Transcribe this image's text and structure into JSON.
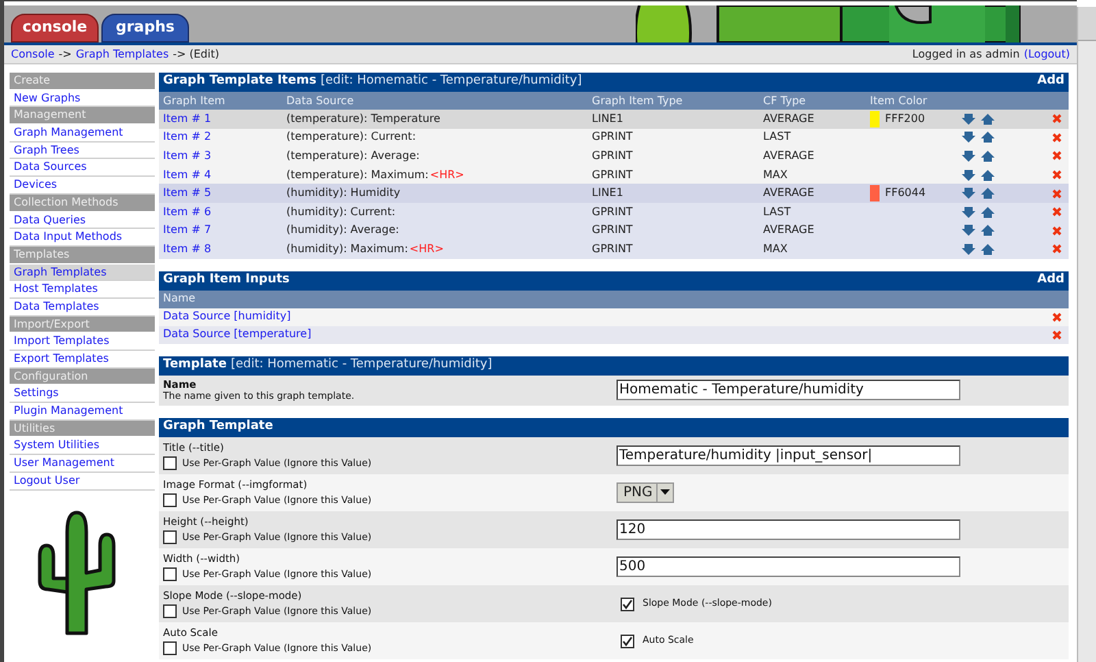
{
  "tabs": [
    {
      "label": "console",
      "selected": true
    },
    {
      "label": "graphs",
      "selected": false
    }
  ],
  "breadcrumb": [
    {
      "label": "Console",
      "kind": "link"
    },
    {
      "label": "->",
      "kind": "sep"
    },
    {
      "label": "Graph Templates",
      "kind": "link"
    },
    {
      "label": "-> (Edit)",
      "kind": "sep"
    }
  ],
  "login": {
    "text": "Logged in as admin",
    "link": "(Logout)"
  },
  "sidebar": [
    {
      "label": "Create",
      "kind": "header"
    },
    {
      "label": "New Graphs",
      "kind": "item",
      "selected": false
    },
    {
      "label": "Management",
      "kind": "header"
    },
    {
      "label": "Graph Management",
      "kind": "item",
      "selected": false
    },
    {
      "label": "Graph Trees",
      "kind": "item",
      "selected": false
    },
    {
      "label": "Data Sources",
      "kind": "item",
      "selected": false
    },
    {
      "label": "Devices",
      "kind": "item",
      "selected": false
    },
    {
      "label": "Collection Methods",
      "kind": "header"
    },
    {
      "label": "Data Queries",
      "kind": "item",
      "selected": false
    },
    {
      "label": "Data Input Methods",
      "kind": "item",
      "selected": false
    },
    {
      "label": "Templates",
      "kind": "header"
    },
    {
      "label": "Graph Templates",
      "kind": "item",
      "selected": true
    },
    {
      "label": "Host Templates",
      "kind": "item",
      "selected": false
    },
    {
      "label": "Data Templates",
      "kind": "item",
      "selected": false
    },
    {
      "label": "Import/Export",
      "kind": "header"
    },
    {
      "label": "Import Templates",
      "kind": "item",
      "selected": false
    },
    {
      "label": "Export Templates",
      "kind": "item",
      "selected": false
    },
    {
      "label": "Configuration",
      "kind": "header"
    },
    {
      "label": "Settings",
      "kind": "item",
      "selected": false
    },
    {
      "label": "Plugin Management",
      "kind": "item",
      "selected": false
    },
    {
      "label": "Utilities",
      "kind": "header"
    },
    {
      "label": "System Utilities",
      "kind": "item",
      "selected": false
    },
    {
      "label": "User Management",
      "kind": "item",
      "selected": false
    },
    {
      "label": "Logout User",
      "kind": "item",
      "selected": false
    }
  ],
  "items_panel": {
    "title": "Graph Template Items",
    "subtitle": "[edit: Homematic - Temperature/humidity]",
    "add": "Add",
    "columns": [
      "Graph Item",
      "Data Source",
      "Graph Item Type",
      "CF Type",
      "Item Color"
    ],
    "rows": [
      {
        "item": "Item # 1",
        "source": "(temperature): Temperature",
        "type": "LINE1",
        "cf": "AVERAGE",
        "color": "#fff200",
        "color_text": "FFF200",
        "tinted": false,
        "highlighted": true
      },
      {
        "item": "Item # 2",
        "source": "(temperature): Current:",
        "type": "GPRINT",
        "cf": "LAST",
        "tinted": false,
        "highlighted": false
      },
      {
        "item": "Item # 3",
        "source": "(temperature): Average:",
        "type": "GPRINT",
        "cf": "AVERAGE",
        "tinted": false,
        "highlighted": false
      },
      {
        "item": "Item # 4",
        "source": "(temperature): Maximum:",
        "suffix": "<HR>",
        "type": "GPRINT",
        "cf": "MAX",
        "tinted": false,
        "highlighted": false
      },
      {
        "item": "Item # 5",
        "source": "(humidity): Humidity",
        "type": "LINE1",
        "cf": "AVERAGE",
        "color": "#ff6044",
        "color_text": "FF6044",
        "tinted": true,
        "highlighted": true
      },
      {
        "item": "Item # 6",
        "source": "(humidity): Current:",
        "type": "GPRINT",
        "cf": "LAST",
        "tinted": true,
        "highlighted": false
      },
      {
        "item": "Item # 7",
        "source": "(humidity): Average:",
        "type": "GPRINT",
        "cf": "AVERAGE",
        "tinted": true,
        "highlighted": false
      },
      {
        "item": "Item # 8",
        "source": "(humidity): Maximum:",
        "suffix": "<HR>",
        "type": "GPRINT",
        "cf": "MAX",
        "tinted": true,
        "highlighted": false
      }
    ]
  },
  "inputs_panel": {
    "title": "Graph Item Inputs",
    "add": "Add",
    "column": "Name",
    "rows": [
      {
        "label": "Data Source [humidity]"
      },
      {
        "label": "Data Source [temperature]"
      }
    ]
  },
  "template_panel": {
    "title": "Template",
    "subtitle": "[edit: Homematic - Temperature/humidity]",
    "name_label": "Name",
    "name_help": "The name given to this graph template.",
    "name_value": "Homematic - Temperature/humidity"
  },
  "graph_panel": {
    "title": "Graph Template",
    "fields": [
      {
        "label": "Title (--title)",
        "per_graph": "Use Per-Graph Value (Ignore this Value)",
        "per_graph_checked": false,
        "kind": "text",
        "value": "Temperature/humidity |input_sensor|"
      },
      {
        "label": "Image Format (--imgformat)",
        "per_graph": "Use Per-Graph Value (Ignore this Value)",
        "per_graph_checked": false,
        "kind": "select",
        "value": "PNG"
      },
      {
        "label": "Height (--height)",
        "per_graph": "Use Per-Graph Value (Ignore this Value)",
        "per_graph_checked": false,
        "kind": "text",
        "value": "120"
      },
      {
        "label": "Width (--width)",
        "per_graph": "Use Per-Graph Value (Ignore this Value)",
        "per_graph_checked": false,
        "kind": "text",
        "value": "500"
      },
      {
        "label": "Slope Mode (--slope-mode)",
        "per_graph": "Use Per-Graph Value (Ignore this Value)",
        "per_graph_checked": false,
        "kind": "checkbox",
        "value": "Slope Mode (--slope-mode)",
        "checked": true
      },
      {
        "label": "Auto Scale",
        "per_graph": "Use Per-Graph Value (Ignore this Value)",
        "per_graph_checked": false,
        "kind": "checkbox",
        "value": "Auto Scale",
        "checked": true
      }
    ]
  }
}
